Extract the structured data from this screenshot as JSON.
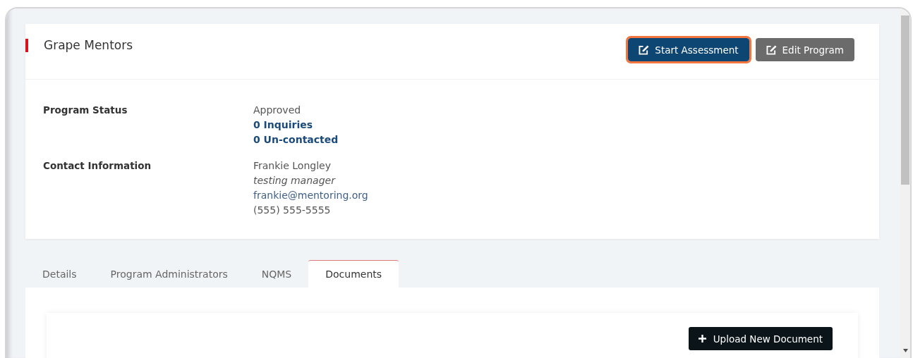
{
  "program": {
    "title": "Grape Mentors"
  },
  "actions": [
    {
      "label": "Start Assessment",
      "kind": "primary",
      "focused": true
    },
    {
      "label": "Edit Program",
      "kind": "secondary",
      "focused": false
    }
  ],
  "details": [
    {
      "label": "Program Status",
      "values": [
        {
          "text": "Approved",
          "kind": "text"
        },
        {
          "text": "0 Inquiries",
          "kind": "link"
        },
        {
          "text": "0 Un-contacted",
          "kind": "link"
        }
      ]
    },
    {
      "label": "Contact Information",
      "values": [
        {
          "text": "Frankie Longley",
          "kind": "text"
        },
        {
          "text": "testing manager",
          "kind": "italic"
        },
        {
          "text": "frankie@mentoring.org",
          "kind": "email"
        },
        {
          "text": "(555) 555-5555",
          "kind": "text"
        }
      ]
    }
  ],
  "tabs": [
    {
      "label": "Details",
      "selected": false
    },
    {
      "label": "Program Administrators",
      "selected": false
    },
    {
      "label": "NQMS",
      "selected": false
    },
    {
      "label": "Documents",
      "selected": true
    }
  ],
  "documents": {
    "upload_button": "Upload New Document"
  }
}
